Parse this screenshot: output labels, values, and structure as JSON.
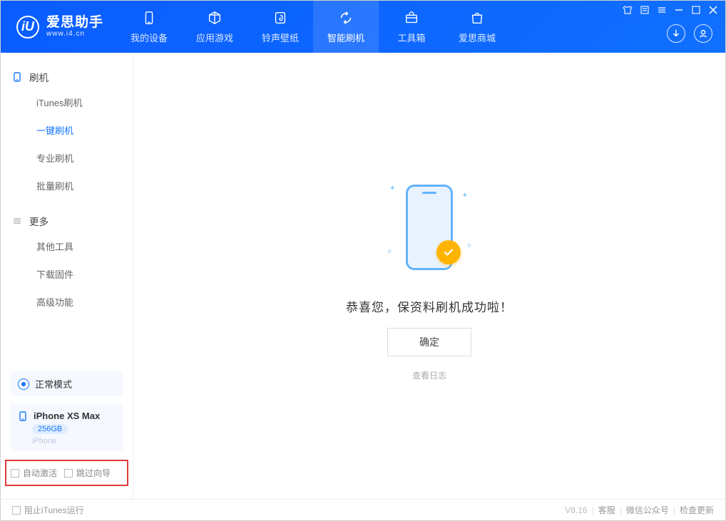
{
  "logo": {
    "icon_letter": "iU",
    "title": "爱思助手",
    "subtitle": "www.i4.cn"
  },
  "nav": {
    "items": [
      {
        "label": "我的设备"
      },
      {
        "label": "应用游戏"
      },
      {
        "label": "铃声壁纸"
      },
      {
        "label": "智能刷机"
      },
      {
        "label": "工具箱"
      },
      {
        "label": "爱思商城"
      }
    ],
    "active_index": 3
  },
  "sidebar": {
    "section_flash": {
      "title": "刷机",
      "items": [
        "iTunes刷机",
        "一键刷机",
        "专业刷机",
        "批量刷机"
      ],
      "active_index": 1
    },
    "section_more": {
      "title": "更多",
      "items": [
        "其他工具",
        "下载固件",
        "高级功能"
      ]
    }
  },
  "device_panel": {
    "mode": "正常模式",
    "name": "iPhone XS Max",
    "storage": "256GB",
    "kind": "iPhone"
  },
  "options": {
    "auto_activate": "自动激活",
    "skip_wizard": "跳过向导"
  },
  "main": {
    "success_text": "恭喜您，保资料刷机成功啦！",
    "ok_button": "确定",
    "view_log": "查看日志"
  },
  "statusbar": {
    "block_itunes": "阻止iTunes运行",
    "version": "V8.16",
    "links": [
      "客服",
      "微信公众号",
      "检查更新"
    ]
  }
}
